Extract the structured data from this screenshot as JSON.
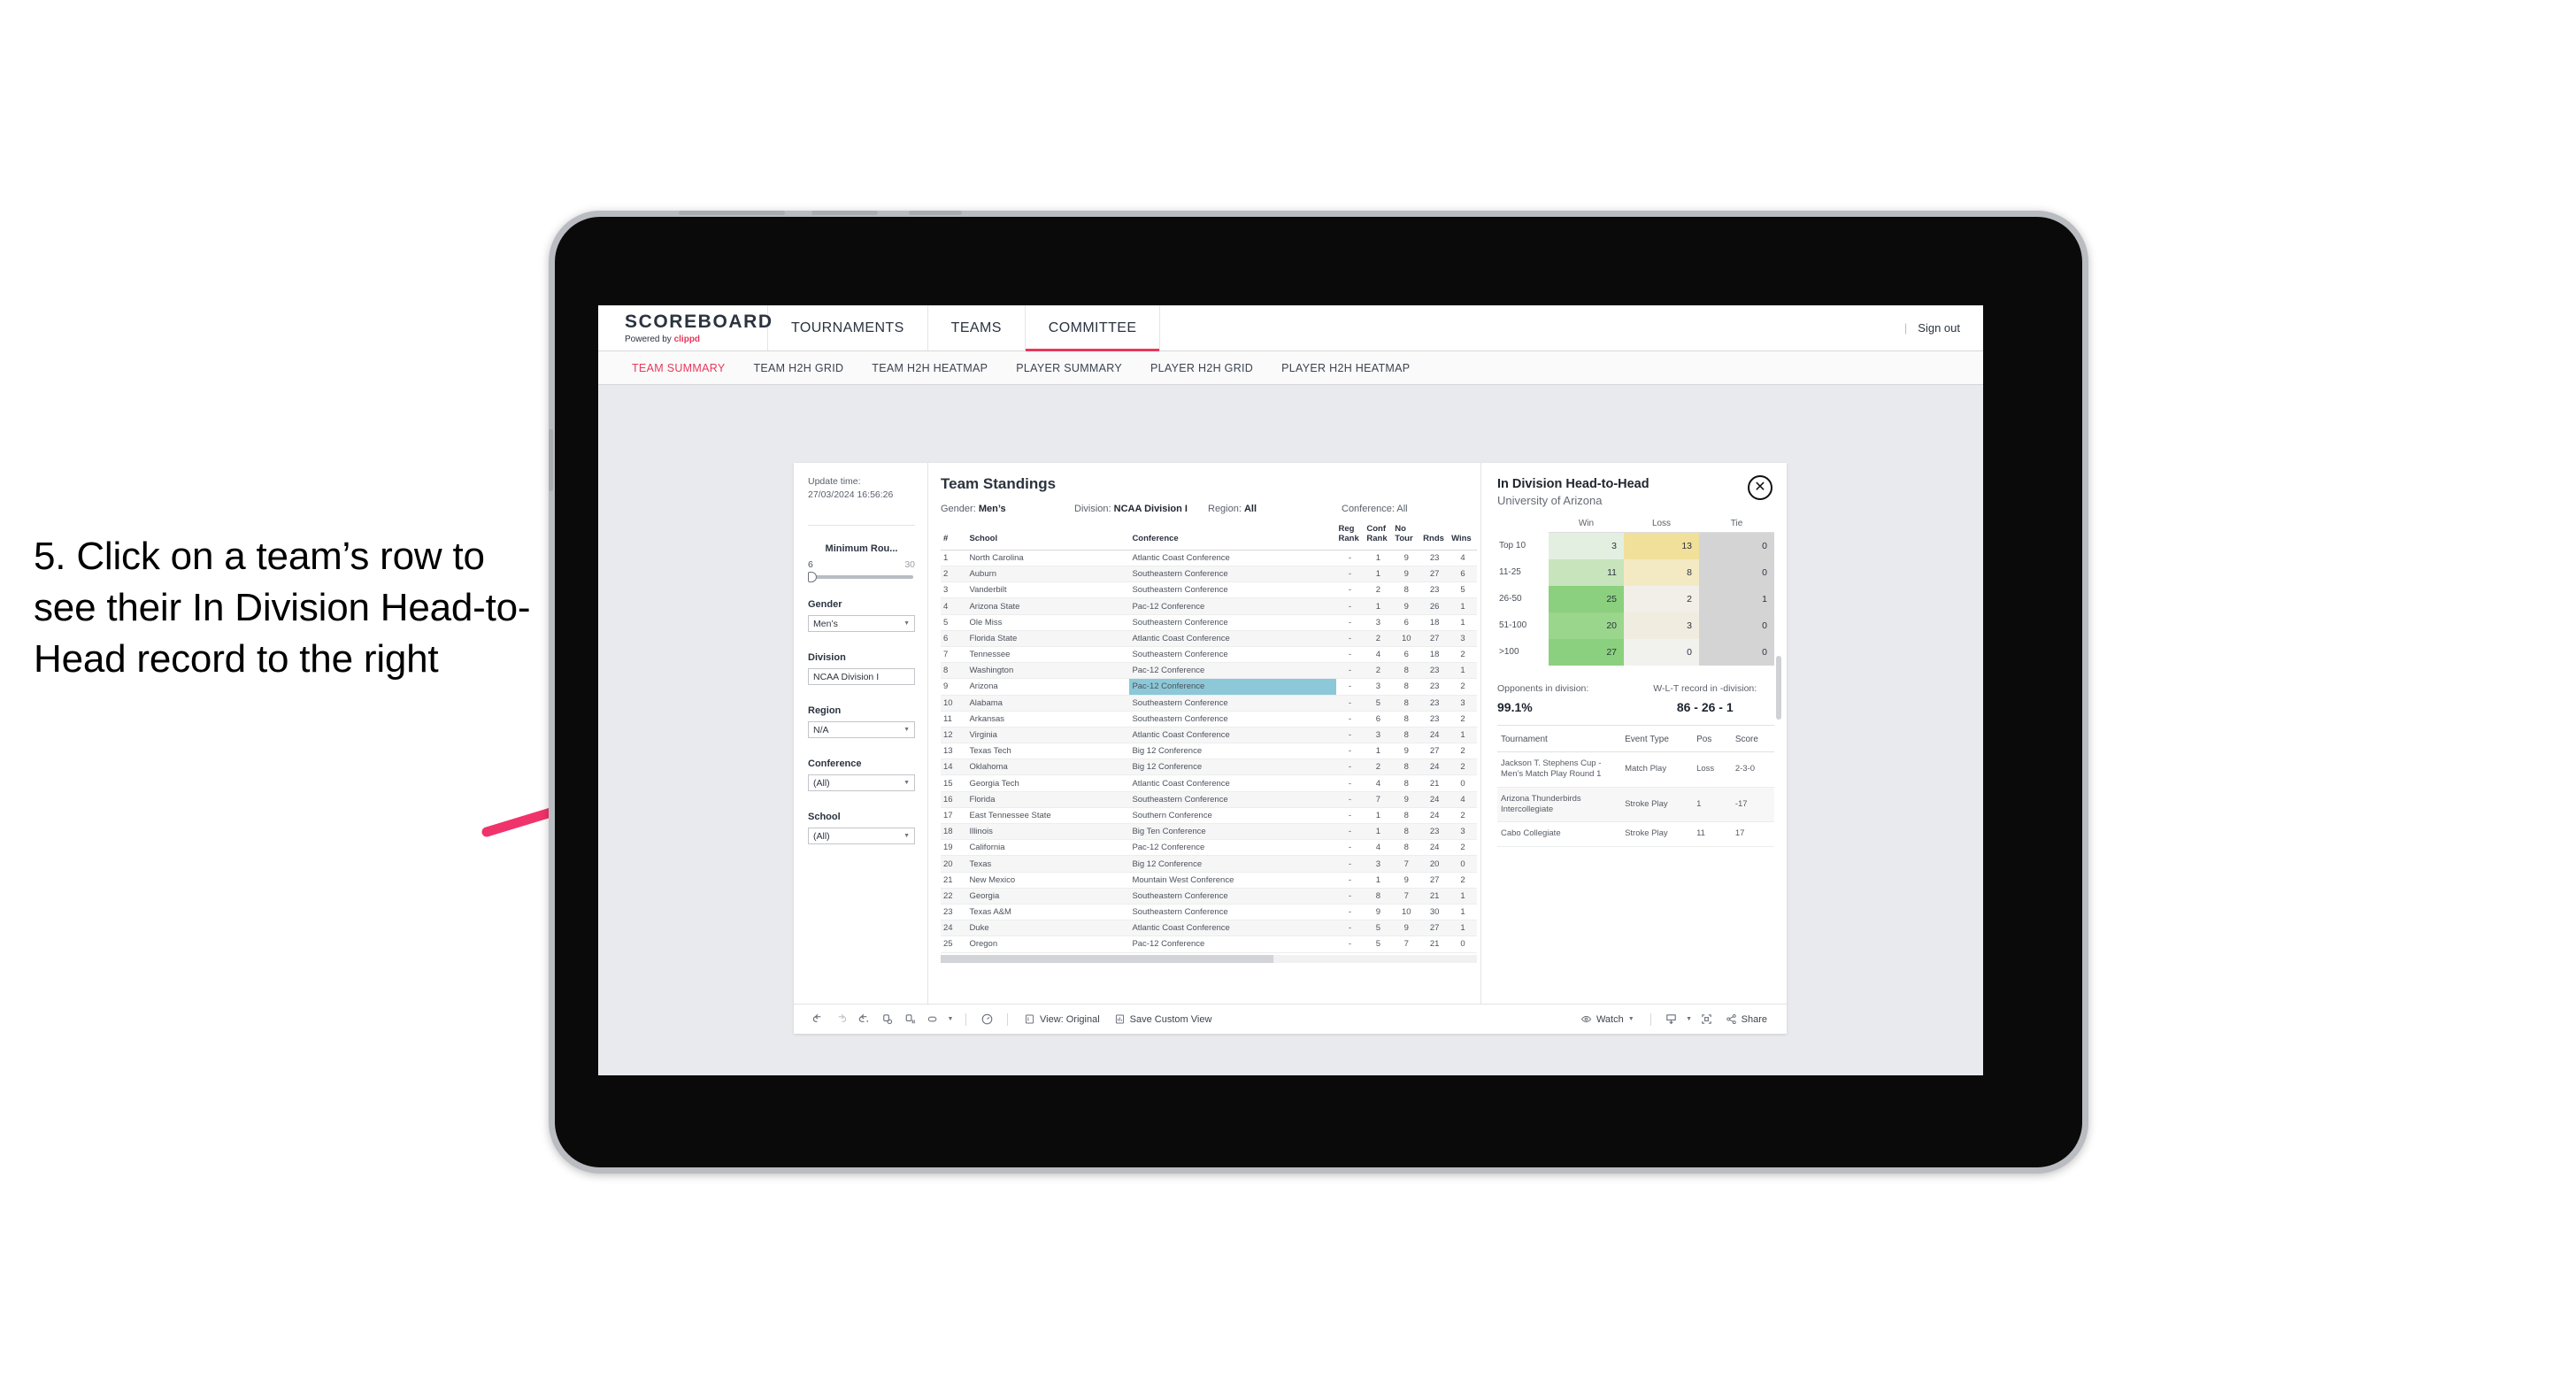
{
  "annotation": {
    "text": "5. Click on a team’s row to see their In Division Head-to-Head record to the right",
    "arrow_color": "#f0336b"
  },
  "app": {
    "brand": {
      "title": "SCOREBOARD",
      "powered_prefix": "Powered by ",
      "powered_name": "clippd"
    },
    "nav": [
      {
        "label": "TOURNAMENTS",
        "active": false
      },
      {
        "label": "TEAMS",
        "active": false
      },
      {
        "label": "COMMITTEE",
        "active": true
      }
    ],
    "sign_out": "Sign out",
    "nav_separator": "|",
    "subnav": [
      {
        "label": "TEAM SUMMARY",
        "active": true
      },
      {
        "label": "TEAM H2H GRID",
        "active": false
      },
      {
        "label": "TEAM H2H HEATMAP",
        "active": false
      },
      {
        "label": "PLAYER SUMMARY",
        "active": false
      },
      {
        "label": "PLAYER H2H GRID",
        "active": false
      },
      {
        "label": "PLAYER H2H HEATMAP",
        "active": false
      }
    ]
  },
  "filters": {
    "update_label": "Update time:",
    "update_value": "27/03/2024 16:56:26",
    "min_rounds": {
      "title": "Minimum Rou...",
      "min": "6",
      "max": "30"
    },
    "groups": [
      {
        "title": "Gender",
        "value": "Men’s"
      },
      {
        "title": "Division",
        "value": "NCAA Division I"
      },
      {
        "title": "Region",
        "value": "N/A"
      },
      {
        "title": "Conference",
        "value": "(All)"
      },
      {
        "title": "School",
        "value": "(All)"
      }
    ]
  },
  "standings": {
    "title": "Team Standings",
    "meta": [
      {
        "label": "Gender:",
        "value": "Men’s"
      },
      {
        "label": "Division:",
        "value": "NCAA Division I"
      },
      {
        "label": "Region:",
        "value": "All"
      },
      {
        "label": "Conference:",
        "value": "All"
      }
    ],
    "columns": [
      "#",
      "School",
      "Conference",
      "Reg Rank",
      "Conf Rank",
      "No Tour",
      "Rnds",
      "Wins"
    ],
    "highlight_row_index": 8,
    "rows": [
      {
        "rank": "1",
        "school": "North Carolina",
        "conference": "Atlantic Coast Conference",
        "reg_rank": "-",
        "conf_rank": "1",
        "no_tour": "9",
        "rnds": "23",
        "wins": "4"
      },
      {
        "rank": "2",
        "school": "Auburn",
        "conference": "Southeastern Conference",
        "reg_rank": "-",
        "conf_rank": "1",
        "no_tour": "9",
        "rnds": "27",
        "wins": "6"
      },
      {
        "rank": "3",
        "school": "Vanderbilt",
        "conference": "Southeastern Conference",
        "reg_rank": "-",
        "conf_rank": "2",
        "no_tour": "8",
        "rnds": "23",
        "wins": "5"
      },
      {
        "rank": "4",
        "school": "Arizona State",
        "conference": "Pac-12 Conference",
        "reg_rank": "-",
        "conf_rank": "1",
        "no_tour": "9",
        "rnds": "26",
        "wins": "1"
      },
      {
        "rank": "5",
        "school": "Ole Miss",
        "conference": "Southeastern Conference",
        "reg_rank": "-",
        "conf_rank": "3",
        "no_tour": "6",
        "rnds": "18",
        "wins": "1"
      },
      {
        "rank": "6",
        "school": "Florida State",
        "conference": "Atlantic Coast Conference",
        "reg_rank": "-",
        "conf_rank": "2",
        "no_tour": "10",
        "rnds": "27",
        "wins": "3"
      },
      {
        "rank": "7",
        "school": "Tennessee",
        "conference": "Southeastern Conference",
        "reg_rank": "-",
        "conf_rank": "4",
        "no_tour": "6",
        "rnds": "18",
        "wins": "2"
      },
      {
        "rank": "8",
        "school": "Washington",
        "conference": "Pac-12 Conference",
        "reg_rank": "-",
        "conf_rank": "2",
        "no_tour": "8",
        "rnds": "23",
        "wins": "1"
      },
      {
        "rank": "9",
        "school": "Arizona",
        "conference": "Pac-12 Conference",
        "reg_rank": "-",
        "conf_rank": "3",
        "no_tour": "8",
        "rnds": "23",
        "wins": "2"
      },
      {
        "rank": "10",
        "school": "Alabama",
        "conference": "Southeastern Conference",
        "reg_rank": "-",
        "conf_rank": "5",
        "no_tour": "8",
        "rnds": "23",
        "wins": "3"
      },
      {
        "rank": "11",
        "school": "Arkansas",
        "conference": "Southeastern Conference",
        "reg_rank": "-",
        "conf_rank": "6",
        "no_tour": "8",
        "rnds": "23",
        "wins": "2"
      },
      {
        "rank": "12",
        "school": "Virginia",
        "conference": "Atlantic Coast Conference",
        "reg_rank": "-",
        "conf_rank": "3",
        "no_tour": "8",
        "rnds": "24",
        "wins": "1"
      },
      {
        "rank": "13",
        "school": "Texas Tech",
        "conference": "Big 12 Conference",
        "reg_rank": "-",
        "conf_rank": "1",
        "no_tour": "9",
        "rnds": "27",
        "wins": "2"
      },
      {
        "rank": "14",
        "school": "Oklahoma",
        "conference": "Big 12 Conference",
        "reg_rank": "-",
        "conf_rank": "2",
        "no_tour": "8",
        "rnds": "24",
        "wins": "2"
      },
      {
        "rank": "15",
        "school": "Georgia Tech",
        "conference": "Atlantic Coast Conference",
        "reg_rank": "-",
        "conf_rank": "4",
        "no_tour": "8",
        "rnds": "21",
        "wins": "0"
      },
      {
        "rank": "16",
        "school": "Florida",
        "conference": "Southeastern Conference",
        "reg_rank": "-",
        "conf_rank": "7",
        "no_tour": "9",
        "rnds": "24",
        "wins": "4"
      },
      {
        "rank": "17",
        "school": "East Tennessee State",
        "conference": "Southern Conference",
        "reg_rank": "-",
        "conf_rank": "1",
        "no_tour": "8",
        "rnds": "24",
        "wins": "2"
      },
      {
        "rank": "18",
        "school": "Illinois",
        "conference": "Big Ten Conference",
        "reg_rank": "-",
        "conf_rank": "1",
        "no_tour": "8",
        "rnds": "23",
        "wins": "3"
      },
      {
        "rank": "19",
        "school": "California",
        "conference": "Pac-12 Conference",
        "reg_rank": "-",
        "conf_rank": "4",
        "no_tour": "8",
        "rnds": "24",
        "wins": "2"
      },
      {
        "rank": "20",
        "school": "Texas",
        "conference": "Big 12 Conference",
        "reg_rank": "-",
        "conf_rank": "3",
        "no_tour": "7",
        "rnds": "20",
        "wins": "0"
      },
      {
        "rank": "21",
        "school": "New Mexico",
        "conference": "Mountain West Conference",
        "reg_rank": "-",
        "conf_rank": "1",
        "no_tour": "9",
        "rnds": "27",
        "wins": "2"
      },
      {
        "rank": "22",
        "school": "Georgia",
        "conference": "Southeastern Conference",
        "reg_rank": "-",
        "conf_rank": "8",
        "no_tour": "7",
        "rnds": "21",
        "wins": "1"
      },
      {
        "rank": "23",
        "school": "Texas A&M",
        "conference": "Southeastern Conference",
        "reg_rank": "-",
        "conf_rank": "9",
        "no_tour": "10",
        "rnds": "30",
        "wins": "1"
      },
      {
        "rank": "24",
        "school": "Duke",
        "conference": "Atlantic Coast Conference",
        "reg_rank": "-",
        "conf_rank": "5",
        "no_tour": "9",
        "rnds": "27",
        "wins": "1"
      },
      {
        "rank": "25",
        "school": "Oregon",
        "conference": "Pac-12 Conference",
        "reg_rank": "-",
        "conf_rank": "5",
        "no_tour": "7",
        "rnds": "21",
        "wins": "0"
      }
    ]
  },
  "h2h": {
    "title": "In Division Head-to-Head",
    "subtitle": "University of Arizona",
    "close_icon": "✕",
    "chart_data": {
      "type": "heatmap",
      "title": "In Division Head-to-Head",
      "subtitle": "University of Arizona",
      "columns": [
        "Win",
        "Loss",
        "Tie"
      ],
      "categories": [
        "Top 10",
        "11-25",
        "26-50",
        "51-100",
        ">100"
      ],
      "rows": [
        {
          "label": "Top 10",
          "win": "3",
          "loss": "13",
          "tie": "0",
          "win_color": "#e3efe1",
          "loss_color": "#f0e09a",
          "tie_color": "#d4d4d4"
        },
        {
          "label": "11-25",
          "win": "11",
          "loss": "8",
          "tie": "0",
          "win_color": "#c8e4bc",
          "loss_color": "#f3eac3",
          "tie_color": "#d4d4d4"
        },
        {
          "label": "26-50",
          "win": "25",
          "loss": "2",
          "tie": "1",
          "win_color": "#8bd07e",
          "loss_color": "#f1efe8",
          "tie_color": "#d4d4d4"
        },
        {
          "label": "51-100",
          "win": "20",
          "loss": "3",
          "tie": "0",
          "win_color": "#9bd68d",
          "loss_color": "#f0ece0",
          "tie_color": "#d4d4d4"
        },
        {
          "label": ">100",
          "win": "27",
          "loss": "0",
          "tie": "0",
          "win_color": "#8bd07e",
          "loss_color": "#f1f1ee",
          "tie_color": "#d4d4d4"
        }
      ]
    },
    "stats": [
      {
        "label": "Opponents in division:",
        "value": "99.1%"
      },
      {
        "label": "W-L-T record in -division:",
        "value": "86 - 26 - 1"
      }
    ],
    "tournament_columns": [
      "Tournament",
      "Event Type",
      "Pos",
      "Score"
    ],
    "tournaments": [
      {
        "name": "Jackson T. Stephens Cup - Men’s Match Play Round 1",
        "type": "Match Play",
        "pos": "Loss",
        "score": "2-3-0"
      },
      {
        "name": "Arizona Thunderbirds Intercollegiate",
        "type": "Stroke Play",
        "pos": "1",
        "score": "-17"
      },
      {
        "name": "Cabo Collegiate",
        "type": "Stroke Play",
        "pos": "11",
        "score": "17"
      }
    ]
  },
  "toolbar": {
    "view_label": "View: Original",
    "save_label": "Save Custom View",
    "watch_label": "Watch",
    "share_label": "Share"
  }
}
